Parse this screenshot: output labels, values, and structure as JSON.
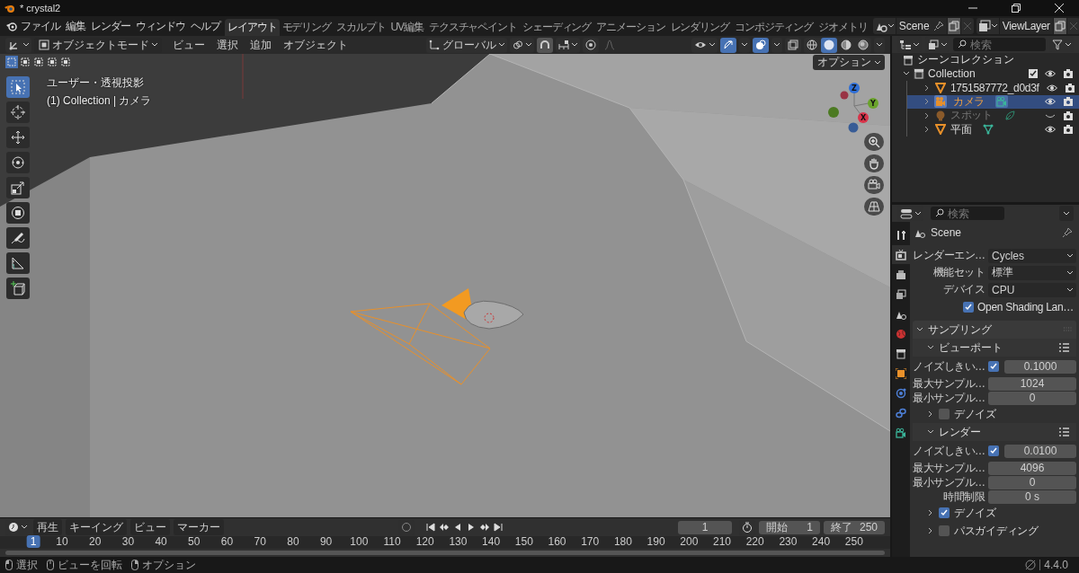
{
  "window": {
    "title": "* crystal2"
  },
  "menu": [
    "ファイル",
    "編集",
    "レンダー",
    "ウィンドウ",
    "ヘルプ"
  ],
  "workspaces": [
    {
      "label": "レイアウト",
      "selected": true
    },
    {
      "label": "モデリング",
      "selected": false
    },
    {
      "label": "スカルプト",
      "selected": false
    },
    {
      "label": "UV編集",
      "selected": false
    },
    {
      "label": "テクスチャペイント",
      "selected": false
    },
    {
      "label": "シェーディング",
      "selected": false
    },
    {
      "label": "アニメーション",
      "selected": false
    },
    {
      "label": "レンダリング",
      "selected": false
    },
    {
      "label": "コンポジティング",
      "selected": false
    },
    {
      "label": "ジオメトリ",
      "selected": false
    }
  ],
  "scene": {
    "name": "Scene"
  },
  "view_layer": {
    "name": "ViewLayer"
  },
  "viewport": {
    "mode": "オブジェクトモード",
    "menus": [
      "ビュー",
      "選択",
      "追加",
      "オブジェクト"
    ],
    "orientation": "グローバル",
    "options": "オプション",
    "info": [
      "ユーザー・透視投影",
      "(1) Collection | カメラ"
    ],
    "select_modes": [
      {
        "selected": true
      },
      {
        "selected": false
      },
      {
        "selected": false
      },
      {
        "selected": false
      },
      {
        "selected": false
      }
    ],
    "shading": [
      {
        "kind": "wireframe",
        "selected": false
      },
      {
        "kind": "solid",
        "selected": true
      },
      {
        "kind": "material",
        "selected": false
      },
      {
        "kind": "rendered",
        "selected": false
      }
    ],
    "tools": [
      {
        "kind": "select",
        "selected": true
      },
      {
        "kind": "cursor",
        "selected": false
      },
      {
        "kind": "move",
        "selected": false
      },
      {
        "kind": "rotate",
        "selected": false
      },
      {
        "kind": "scale",
        "selected": false
      },
      {
        "kind": "transform",
        "selected": false
      },
      {
        "kind": "annotate",
        "selected": false
      },
      {
        "kind": "measure",
        "selected": false
      },
      {
        "kind": "add_cube",
        "selected": false
      }
    ],
    "gizmo": {
      "z": "Z",
      "y": "Y",
      "x": "X"
    }
  },
  "outliner": {
    "search": {
      "placeholder": "検索"
    },
    "root": "シーンコレクション",
    "collection": {
      "name": "Collection",
      "checked": true,
      "expanded": true,
      "children": [
        {
          "name": "1751587772_d0d3f",
          "kind": "mesh",
          "selected": false,
          "visible": true,
          "has_data": false
        },
        {
          "name": "カメラ",
          "kind": "camera",
          "selected": true,
          "visible": true,
          "has_data": true
        },
        {
          "name": "スポット",
          "kind": "light",
          "selected": false,
          "visible": false,
          "has_data": true
        },
        {
          "name": "平面",
          "kind": "mesh",
          "selected": false,
          "visible": true,
          "has_data": true
        }
      ]
    }
  },
  "properties": {
    "search": {
      "placeholder": "検索"
    },
    "context": "Scene",
    "tabs": [
      {
        "kind": "tool",
        "selected": false
      },
      {
        "kind": "render",
        "selected": true
      },
      {
        "kind": "output",
        "selected": false
      },
      {
        "kind": "view_layer",
        "selected": false
      },
      {
        "kind": "scene",
        "selected": false
      },
      {
        "kind": "world",
        "selected": false
      },
      {
        "kind": "collection",
        "selected": false
      },
      {
        "kind": "object",
        "selected": false
      },
      {
        "kind": "physics",
        "selected": false
      },
      {
        "kind": "constraint",
        "selected": false
      },
      {
        "kind": "data",
        "selected": false
      }
    ],
    "rows": [
      {
        "kind": "dropdown",
        "label": "レンダーエン…",
        "value": "Cycles"
      },
      {
        "kind": "dropdown",
        "label": "機能セット",
        "value": "標準"
      },
      {
        "kind": "dropdown",
        "label": "デバイス",
        "value": "CPU"
      },
      {
        "kind": "checkbox",
        "label": "Open Shading Lan…",
        "checked": true
      },
      {
        "kind": "panel",
        "label": "サンプリング",
        "expanded": true
      },
      {
        "kind": "subpanel",
        "label": "ビューポート",
        "expanded": true
      },
      {
        "kind": "check_number",
        "label": "ノイズしきい…",
        "checked": true,
        "value": "0.1000"
      },
      {
        "kind": "number",
        "label": "最大サンプル…",
        "value": "1024"
      },
      {
        "kind": "number",
        "label": "最小サンプル…",
        "value": "0"
      },
      {
        "kind": "subpanel_check",
        "label": "デノイズ",
        "expanded": false,
        "checked": false
      },
      {
        "kind": "subpanel",
        "label": "レンダー",
        "expanded": true
      },
      {
        "kind": "check_number",
        "label": "ノイズしきい…",
        "checked": true,
        "value": "0.0100"
      },
      {
        "kind": "number",
        "label": "最大サンプル…",
        "value": "4096"
      },
      {
        "kind": "number",
        "label": "最小サンプル…",
        "value": "0"
      },
      {
        "kind": "number",
        "label": "時間制限",
        "value": "0 s"
      },
      {
        "kind": "subpanel_check",
        "label": "デノイズ",
        "expanded": false,
        "checked": true
      },
      {
        "kind": "subpanel_check",
        "label": "パスガイディング",
        "expanded": false,
        "checked": false
      }
    ]
  },
  "timeline": {
    "menus": [
      "再生",
      "キーイング",
      "ビュー",
      "マーカー"
    ],
    "frame": "1",
    "start_label": "開始",
    "start": "1",
    "end_label": "終了",
    "end": "250",
    "ticks": [
      {
        "label": "1",
        "selected": true
      },
      {
        "label": "10",
        "selected": false
      },
      {
        "label": "20",
        "selected": false
      },
      {
        "label": "30",
        "selected": false
      },
      {
        "label": "40",
        "selected": false
      },
      {
        "label": "50",
        "selected": false
      },
      {
        "label": "60",
        "selected": false
      },
      {
        "label": "70",
        "selected": false
      },
      {
        "label": "80",
        "selected": false
      },
      {
        "label": "90",
        "selected": false
      },
      {
        "label": "100",
        "selected": false
      },
      {
        "label": "110",
        "selected": false
      },
      {
        "label": "120",
        "selected": false
      },
      {
        "label": "130",
        "selected": false
      },
      {
        "label": "140",
        "selected": false
      },
      {
        "label": "150",
        "selected": false
      },
      {
        "label": "160",
        "selected": false
      },
      {
        "label": "170",
        "selected": false
      },
      {
        "label": "180",
        "selected": false
      },
      {
        "label": "190",
        "selected": false
      },
      {
        "label": "200",
        "selected": false
      },
      {
        "label": "210",
        "selected": false
      },
      {
        "label": "220",
        "selected": false
      },
      {
        "label": "230",
        "selected": false
      },
      {
        "label": "240",
        "selected": false
      },
      {
        "label": "250",
        "selected": false
      }
    ]
  },
  "status_bar": {
    "hints": [
      "選択",
      "ビューを回転",
      "オプション"
    ],
    "version": "4.4.0"
  }
}
